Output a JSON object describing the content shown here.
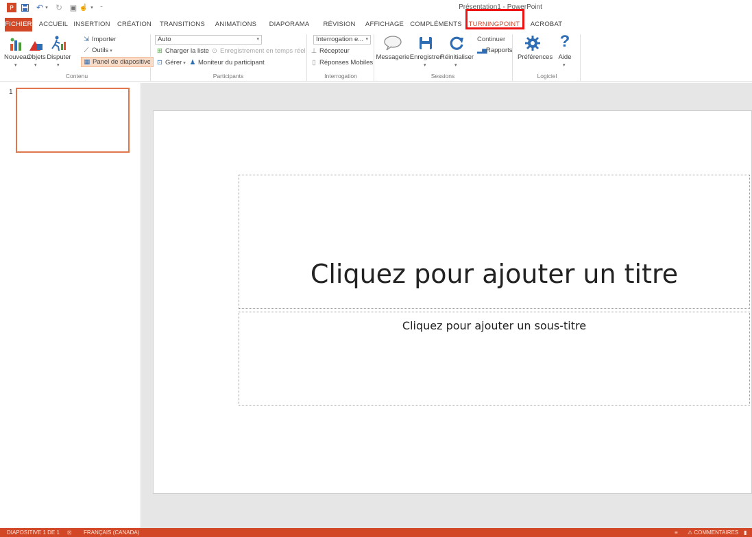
{
  "window": {
    "title": "Présentation1 - PowerPoint"
  },
  "quick_access": {
    "app_icon": "powerpoint-icon",
    "save_icon": "save-icon",
    "undo_icon": "undo-icon",
    "redo_icon": "redo-icon",
    "start_icon": "start-from-beginning-icon",
    "customize_icon": "customize-qat-icon"
  },
  "tabs": [
    {
      "label": "FICHIER"
    },
    {
      "label": "ACCUEIL"
    },
    {
      "label": "INSERTION"
    },
    {
      "label": "CRÉATION"
    },
    {
      "label": "TRANSITIONS"
    },
    {
      "label": "ANIMATIONS"
    },
    {
      "label": "DIAPORAMA"
    },
    {
      "label": "RÉVISION"
    },
    {
      "label": "AFFICHAGE"
    },
    {
      "label": "COMPLÉMENTS"
    },
    {
      "label": "TURNINGPOINT"
    },
    {
      "label": "ACROBAT"
    }
  ],
  "ribbon": {
    "contenu": {
      "label": "Contenu",
      "nouveau": "Nouveau",
      "objets": "Objets",
      "disputer": "Disputer",
      "importer": "Importer",
      "outils": "Outils",
      "panel": "Panel de diapositive"
    },
    "participants": {
      "label": "Participants",
      "list_value": "Auto",
      "charger": "Charger la liste",
      "enregistrement": "Enregistrement en temps réel",
      "gerer": "Gérer",
      "moniteur": "Moniteur du participant"
    },
    "interrogation": {
      "label": "Interrogation",
      "mode_value": "Interrogation e...",
      "recepteur": "Récepteur",
      "reponses": "Réponses Mobiles"
    },
    "sessions": {
      "label": "Sessions",
      "messagerie": "Messagerie",
      "enregistrer": "Enregistrer",
      "reinitialiser": "Réinitialiser",
      "continuer": "Continuer",
      "rapports": "Rapports"
    },
    "logiciel": {
      "label": "Logiciel",
      "preferences": "Préférences",
      "aide": "Aide"
    }
  },
  "thumbnails": {
    "number": "1"
  },
  "slide": {
    "title_placeholder": "Cliquez pour ajouter un titre",
    "subtitle_placeholder": "Cliquez pour ajouter un sous-titre"
  },
  "status": {
    "slide_info": "DIAPOSITIVE 1 DE 1",
    "language": "FRANÇAIS (CANADA)",
    "comments": "COMMENTAIRES"
  },
  "colors": {
    "accent": "#d24726",
    "highlight_box": "#ee1111"
  }
}
